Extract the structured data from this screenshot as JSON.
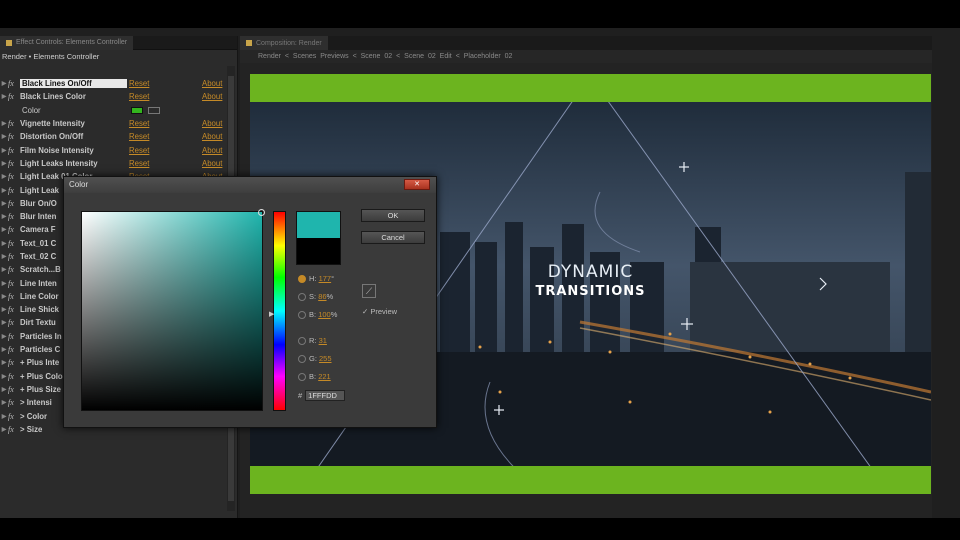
{
  "left_panel": {
    "tab_label": "Effect Controls: Elements Controller",
    "breadcrumb": "Render • Elements Controller",
    "rows": [
      {
        "name": "Black Lines On/Off",
        "reset": "Reset",
        "about": "About",
        "highlight": true
      },
      {
        "name": "Black Lines Color",
        "reset": "Reset",
        "about": "About"
      },
      {
        "name": "Color",
        "sub": true
      },
      {
        "name": "Vignette Intensity",
        "reset": "Reset",
        "about": "About"
      },
      {
        "name": "Distortion On/Off",
        "reset": "Reset",
        "about": "About"
      },
      {
        "name": "Film Noise Intensity",
        "reset": "Reset",
        "about": "About"
      },
      {
        "name": "Light Leaks Intensity",
        "reset": "Reset",
        "about": "About"
      },
      {
        "name": "Light Leak 01 Color",
        "reset": "Reset",
        "about": "About"
      },
      {
        "name": "Light Leak"
      },
      {
        "name": "Blur On/O"
      },
      {
        "name": "Blur Inten"
      },
      {
        "name": "Camera F"
      },
      {
        "name": "Text_01 C"
      },
      {
        "name": "Text_02 C"
      },
      {
        "name": "Scratch...B"
      },
      {
        "name": "Line Inten"
      },
      {
        "name": "Line Color"
      },
      {
        "name": "Line Shick"
      },
      {
        "name": "Dirt Textu"
      },
      {
        "name": "Particles In"
      },
      {
        "name": "Particles C"
      },
      {
        "name": "+ Plus Inte"
      },
      {
        "name": "+ Plus Colo"
      },
      {
        "name": "+ Plus Size"
      },
      {
        "name": "> Intensi"
      },
      {
        "name": "> Color"
      },
      {
        "name": "> Size"
      }
    ]
  },
  "comp_panel": {
    "tab_label": "Composition: Render",
    "path": "Render  <  Scenes Previews  <  Scene 02  <  Scene 02 Edit  <  Placeholder 02"
  },
  "viewer": {
    "title_line1": "DYNAMIC",
    "title_line2": "TRANSITIONS"
  },
  "dialog": {
    "title": "Color",
    "close_glyph": "✕",
    "ok_label": "OK",
    "cancel_label": "Cancel",
    "preview_label": "Preview",
    "preview_check": "✓",
    "fields": [
      {
        "key": "H",
        "value": "177",
        "unit": "°",
        "selected": true
      },
      {
        "key": "S",
        "value": "86",
        "unit": "%"
      },
      {
        "key": "B",
        "value": "100",
        "unit": "%"
      },
      {
        "key": "R",
        "value": "31"
      },
      {
        "key": "G",
        "value": "255"
      },
      {
        "key": "B",
        "value": "221"
      }
    ],
    "hex_prefix": "#",
    "hex_value": "1FFFDD",
    "new_color": "#1fb5ad",
    "old_color": "#000000"
  }
}
